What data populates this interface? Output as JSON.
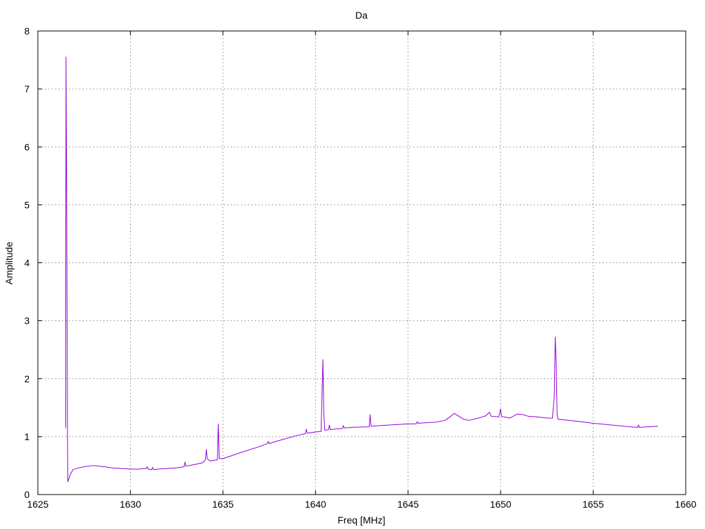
{
  "chart_data": {
    "type": "line",
    "title": "Da",
    "xlabel": "Freq [MHz]",
    "ylabel": "Amplitude",
    "xlim": [
      1625,
      1660
    ],
    "ylim": [
      0,
      8
    ],
    "x_ticks": [
      "1625",
      "1630",
      "1635",
      "1640",
      "1645",
      "1650",
      "1655",
      "1660"
    ],
    "y_ticks": [
      "0",
      "1",
      "2",
      "3",
      "4",
      "5",
      "6",
      "7",
      "8"
    ],
    "grid": true,
    "legend": "none",
    "series": [
      {
        "color": "#9400d3",
        "points": [
          [
            1626.5,
            1.15
          ],
          [
            1626.51,
            4.8
          ],
          [
            1626.52,
            7.55
          ],
          [
            1626.56,
            4.8
          ],
          [
            1626.6,
            1.0
          ],
          [
            1626.62,
            0.22
          ],
          [
            1626.75,
            0.35
          ],
          [
            1626.9,
            0.43
          ],
          [
            1627.2,
            0.46
          ],
          [
            1627.5,
            0.48
          ],
          [
            1628.0,
            0.5
          ],
          [
            1628.3,
            0.49
          ],
          [
            1628.6,
            0.48
          ],
          [
            1629.0,
            0.46
          ],
          [
            1629.5,
            0.45
          ],
          [
            1630.0,
            0.44
          ],
          [
            1630.5,
            0.44
          ],
          [
            1630.85,
            0.45
          ],
          [
            1630.9,
            0.48
          ],
          [
            1630.95,
            0.44
          ],
          [
            1631.15,
            0.43
          ],
          [
            1631.2,
            0.47
          ],
          [
            1631.25,
            0.43
          ],
          [
            1631.5,
            0.44
          ],
          [
            1632.0,
            0.45
          ],
          [
            1632.5,
            0.46
          ],
          [
            1632.9,
            0.48
          ],
          [
            1632.95,
            0.56
          ],
          [
            1633.0,
            0.49
          ],
          [
            1633.5,
            0.52
          ],
          [
            1633.9,
            0.55
          ],
          [
            1634.05,
            0.6
          ],
          [
            1634.1,
            0.78
          ],
          [
            1634.15,
            0.62
          ],
          [
            1634.3,
            0.58
          ],
          [
            1634.7,
            0.6
          ],
          [
            1634.75,
            1.22
          ],
          [
            1634.8,
            0.62
          ],
          [
            1635.0,
            0.62
          ],
          [
            1636.0,
            0.73
          ],
          [
            1637.0,
            0.83
          ],
          [
            1637.4,
            0.88
          ],
          [
            1637.45,
            0.92
          ],
          [
            1637.5,
            0.88
          ],
          [
            1638.0,
            0.93
          ],
          [
            1639.0,
            1.02
          ],
          [
            1639.45,
            1.05
          ],
          [
            1639.5,
            1.13
          ],
          [
            1639.55,
            1.06
          ],
          [
            1640.0,
            1.08
          ],
          [
            1640.3,
            1.09
          ],
          [
            1640.4,
            2.33
          ],
          [
            1640.45,
            1.4
          ],
          [
            1640.5,
            1.11
          ],
          [
            1640.7,
            1.12
          ],
          [
            1640.75,
            1.2
          ],
          [
            1640.8,
            1.12
          ],
          [
            1641.0,
            1.13
          ],
          [
            1641.45,
            1.14
          ],
          [
            1641.5,
            1.19
          ],
          [
            1641.55,
            1.15
          ],
          [
            1642.0,
            1.16
          ],
          [
            1642.9,
            1.17
          ],
          [
            1642.95,
            1.38
          ],
          [
            1643.0,
            1.18
          ],
          [
            1643.5,
            1.19
          ],
          [
            1644.0,
            1.2
          ],
          [
            1645.0,
            1.22
          ],
          [
            1645.45,
            1.22
          ],
          [
            1645.5,
            1.26
          ],
          [
            1645.55,
            1.23
          ],
          [
            1646.0,
            1.24
          ],
          [
            1646.5,
            1.25
          ],
          [
            1647.0,
            1.28
          ],
          [
            1647.3,
            1.35
          ],
          [
            1647.5,
            1.4
          ],
          [
            1647.7,
            1.36
          ],
          [
            1648.0,
            1.3
          ],
          [
            1648.3,
            1.28
          ],
          [
            1648.8,
            1.32
          ],
          [
            1649.2,
            1.36
          ],
          [
            1649.4,
            1.42
          ],
          [
            1649.5,
            1.35
          ],
          [
            1649.9,
            1.34
          ],
          [
            1650.0,
            1.48
          ],
          [
            1650.05,
            1.35
          ],
          [
            1650.5,
            1.32
          ],
          [
            1650.9,
            1.39
          ],
          [
            1651.2,
            1.38
          ],
          [
            1651.5,
            1.35
          ],
          [
            1652.0,
            1.34
          ],
          [
            1652.5,
            1.32
          ],
          [
            1652.8,
            1.32
          ],
          [
            1652.9,
            1.7
          ],
          [
            1652.95,
            2.72
          ],
          [
            1653.0,
            2.3
          ],
          [
            1653.05,
            1.4
          ],
          [
            1653.1,
            1.3
          ],
          [
            1654.0,
            1.27
          ],
          [
            1655.0,
            1.23
          ],
          [
            1656.0,
            1.2
          ],
          [
            1657.0,
            1.17
          ],
          [
            1657.4,
            1.16
          ],
          [
            1657.45,
            1.2
          ],
          [
            1657.5,
            1.16
          ],
          [
            1658.0,
            1.17
          ],
          [
            1658.5,
            1.18
          ]
        ]
      }
    ]
  }
}
